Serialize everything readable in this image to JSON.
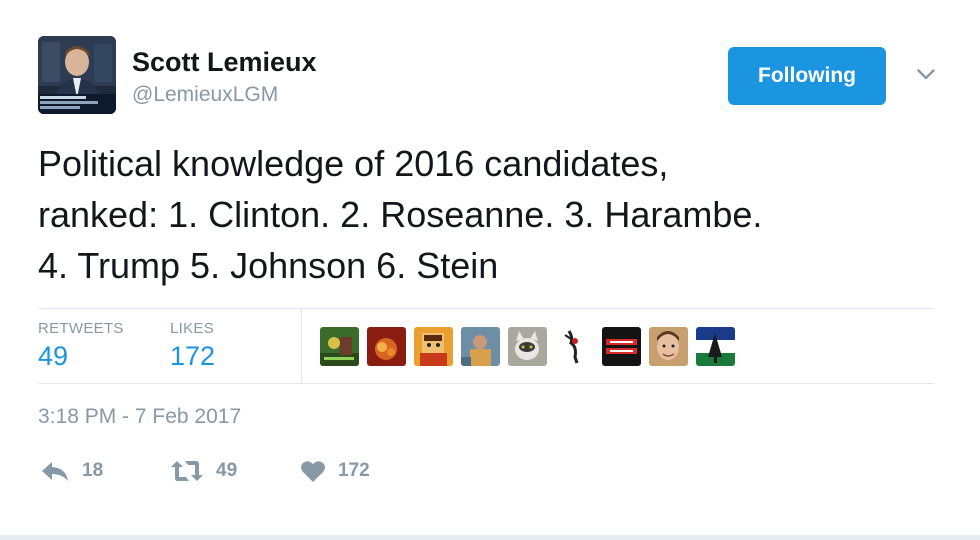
{
  "author": {
    "name": "Scott Lemieux",
    "handle": "@LemieuxLGM"
  },
  "follow_button": {
    "label": "Following"
  },
  "tweet": {
    "text": "Political knowledge of 2016 candidates,\nranked: 1. Clinton. 2. Roseanne. 3. Harambe.\n4. Trump 5. Johnson 6. Stein",
    "timestamp": "3:18 PM - 7 Feb 2017"
  },
  "stats": {
    "retweets_label": "RETWEETS",
    "retweets_value": "49",
    "likes_label": "LIKES",
    "likes_value": "172"
  },
  "liker_avatars": [
    "avatar-1",
    "avatar-2",
    "avatar-3",
    "avatar-4",
    "avatar-5",
    "avatar-6",
    "avatar-7",
    "avatar-8",
    "avatar-9"
  ],
  "actions": {
    "reply_count": "18",
    "retweet_count": "49",
    "like_count": "172"
  },
  "icons": {
    "caret": "chevron-down-icon",
    "reply": "reply-icon",
    "retweet": "retweet-icon",
    "like": "heart-icon"
  },
  "colors": {
    "accent": "#1b95e0",
    "muted": "#8899a6",
    "text": "#14171a",
    "border": "#e1e8ed"
  }
}
